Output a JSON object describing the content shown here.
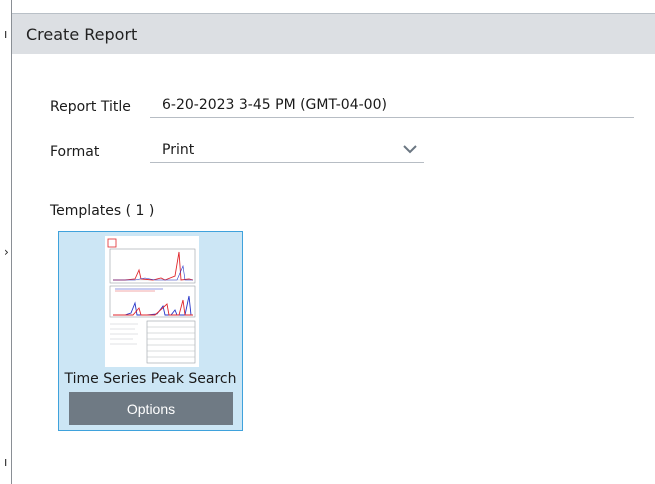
{
  "dialog": {
    "title": "Create Report"
  },
  "form": {
    "report_title_label": "Report Title",
    "report_title_value": "6-20-2023 3-45 PM (GMT-04-00)",
    "format_label": "Format",
    "format_value": "Print"
  },
  "templates": {
    "heading": "Templates ( 1 )",
    "items": [
      {
        "name": "Time Series Peak Search",
        "options_label": "Options"
      }
    ]
  },
  "colors": {
    "header_bg": "#dcdfe3",
    "card_bg": "#cce6f5",
    "card_border": "#3fa2dc",
    "options_bg": "#6f7a84",
    "chart_red": "#e0262b",
    "chart_blue": "#2635c8"
  }
}
